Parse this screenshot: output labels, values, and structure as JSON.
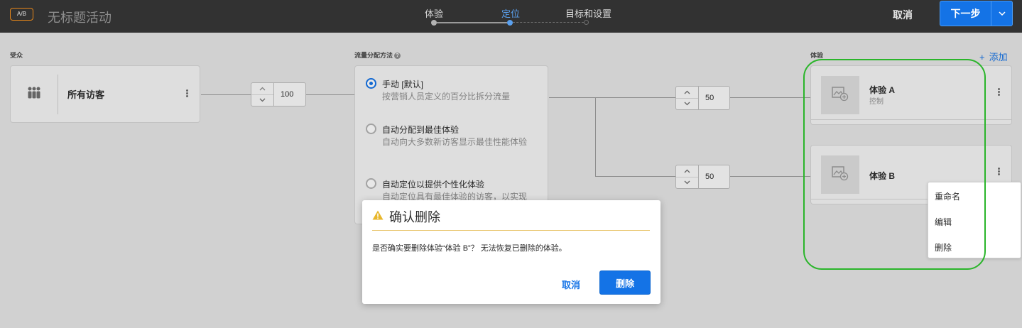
{
  "header": {
    "badge": "A/B",
    "activity_title": "无标题活动",
    "steps": [
      {
        "label": "体验",
        "state": "done"
      },
      {
        "label": "定位",
        "state": "active"
      },
      {
        "label": "目标和设置",
        "state": "pending"
      }
    ],
    "cancel_label": "取消",
    "next_label": "下一步"
  },
  "audience": {
    "section_label": "受众",
    "name": "所有访客",
    "icon": "people-icon",
    "traffic_value": "100"
  },
  "traffic_method": {
    "section_label": "流量分配方法",
    "options": [
      {
        "title": "手动 [默认]",
        "desc": "按营销人员定义的百分比拆分流量",
        "selected": true
      },
      {
        "title": "自动分配到最佳体验",
        "desc": "自动向大多数新访客显示最佳性能体验",
        "selected": false
      },
      {
        "title": "自动定位以提供个性化体验",
        "desc": "自动定位具有最佳体验的访客，以实现",
        "selected": false
      }
    ]
  },
  "experiences": {
    "section_label": "体验",
    "add_label": "添加",
    "items": [
      {
        "name": "体验 A",
        "sub": "控制",
        "allocation": "50"
      },
      {
        "name": "体验 B",
        "sub": "",
        "allocation": "50"
      }
    ]
  },
  "context_menu": {
    "items": [
      "重命名",
      "编辑",
      "删除"
    ]
  },
  "dialog": {
    "title": "确认删除",
    "message": "是否确实要删除体验“体验 B”？ 无法恢复已删除的体验。",
    "cancel_label": "取消",
    "delete_label": "删除"
  },
  "colors": {
    "accent": "#1473e6",
    "highlight": "#2ab52a",
    "warning": "#e68619",
    "topbar": "#323232"
  }
}
